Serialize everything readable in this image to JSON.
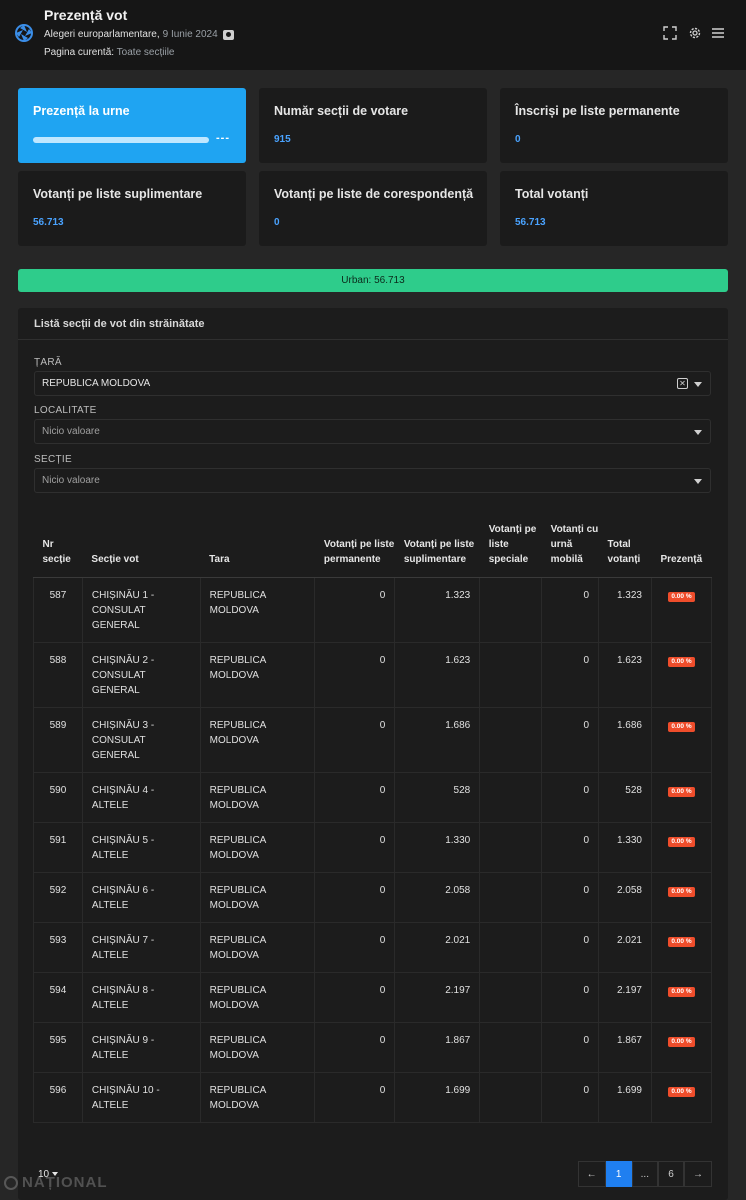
{
  "header": {
    "title": "Prezență vot",
    "election": "Alegeri europarlamentare,",
    "date": "9 Iunie 2024",
    "current_page_label": "Pagina curentă:",
    "current_page_value": "Toate secțiile",
    "icons": [
      "fullscreen-icon",
      "gear-icon",
      "menu-icon"
    ]
  },
  "cards": [
    {
      "title": "Prezență la urne",
      "value": "---",
      "progress": 0
    },
    {
      "title": "Număr secții de votare",
      "value": "915"
    },
    {
      "title": "Înscriși pe liste permanente",
      "value": "0"
    },
    {
      "title": "Votanți pe liste suplimentare",
      "value": "56.713"
    },
    {
      "title": "Votanți pe liste de corespondență",
      "value": "0"
    },
    {
      "title": "Total votanți",
      "value": "56.713"
    }
  ],
  "urban_bar": "Urban: 56.713",
  "panel": {
    "title": "Listă secții de vot din străinătate",
    "filters": [
      {
        "label": "ȚARĂ",
        "value": "REPUBLICA MOLDOVA",
        "placeholder": ""
      },
      {
        "label": "LOCALITATE",
        "value": "",
        "placeholder": "Nicio valoare"
      },
      {
        "label": "SECȚIE",
        "value": "",
        "placeholder": "Nicio valoare"
      }
    ]
  },
  "table": {
    "headers": [
      "Nr secție",
      "Secție vot",
      "Tara",
      "Votanți pe liste permanente",
      "Votanți pe liste suplimentare",
      "Votanți pe liste speciale",
      "Votanți cu urnă mobilă",
      "Total votanți",
      "Prezență"
    ],
    "rows": [
      {
        "nr": "587",
        "sectie": "CHIȘINĂU 1 - CONSULAT GENERAL",
        "tara": "REPUBLICA MOLDOVA",
        "perm": "0",
        "supl": "1.323",
        "spec": "",
        "mobil": "0",
        "total": "1.323",
        "prez": "0.00 %"
      },
      {
        "nr": "588",
        "sectie": "CHIȘINĂU 2 - CONSULAT GENERAL",
        "tara": "REPUBLICA MOLDOVA",
        "perm": "0",
        "supl": "1.623",
        "spec": "",
        "mobil": "0",
        "total": "1.623",
        "prez": "0.00 %"
      },
      {
        "nr": "589",
        "sectie": "CHIȘINĂU 3 - CONSULAT GENERAL",
        "tara": "REPUBLICA MOLDOVA",
        "perm": "0",
        "supl": "1.686",
        "spec": "",
        "mobil": "0",
        "total": "1.686",
        "prez": "0.00 %"
      },
      {
        "nr": "590",
        "sectie": "CHIȘINĂU 4 - ALTELE",
        "tara": "REPUBLICA MOLDOVA",
        "perm": "0",
        "supl": "528",
        "spec": "",
        "mobil": "0",
        "total": "528",
        "prez": "0.00 %"
      },
      {
        "nr": "591",
        "sectie": "CHIȘINĂU 5 - ALTELE",
        "tara": "REPUBLICA MOLDOVA",
        "perm": "0",
        "supl": "1.330",
        "spec": "",
        "mobil": "0",
        "total": "1.330",
        "prez": "0.00 %"
      },
      {
        "nr": "592",
        "sectie": "CHIȘINĂU 6 - ALTELE",
        "tara": "REPUBLICA MOLDOVA",
        "perm": "0",
        "supl": "2.058",
        "spec": "",
        "mobil": "0",
        "total": "2.058",
        "prez": "0.00 %"
      },
      {
        "nr": "593",
        "sectie": "CHIȘINĂU 7 - ALTELE",
        "tara": "REPUBLICA MOLDOVA",
        "perm": "0",
        "supl": "2.021",
        "spec": "",
        "mobil": "0",
        "total": "2.021",
        "prez": "0.00 %"
      },
      {
        "nr": "594",
        "sectie": "CHIȘINĂU 8 - ALTELE",
        "tara": "REPUBLICA MOLDOVA",
        "perm": "0",
        "supl": "2.197",
        "spec": "",
        "mobil": "0",
        "total": "2.197",
        "prez": "0.00 %"
      },
      {
        "nr": "595",
        "sectie": "CHIȘINĂU 9 - ALTELE",
        "tara": "REPUBLICA MOLDOVA",
        "perm": "0",
        "supl": "1.867",
        "spec": "",
        "mobil": "0",
        "total": "1.867",
        "prez": "0.00 %"
      },
      {
        "nr": "596",
        "sectie": "CHIȘINĂU 10 - ALTELE",
        "tara": "REPUBLICA MOLDOVA",
        "perm": "0",
        "supl": "1.699",
        "spec": "",
        "mobil": "0",
        "total": "1.699",
        "prez": "0.00 %"
      }
    ]
  },
  "pagination": {
    "per_page": "10",
    "prev": "←",
    "pages": [
      "1",
      "...",
      "6"
    ],
    "active": "1",
    "next": "→"
  },
  "watermark": "NAȚIONAL",
  "colors": {
    "accent": "#1fa4f2",
    "value_blue": "#4aa3ff",
    "urban_green": "#2ecc8b",
    "badge_red": "#ef4d2b",
    "page_active": "#1f7ff0"
  }
}
